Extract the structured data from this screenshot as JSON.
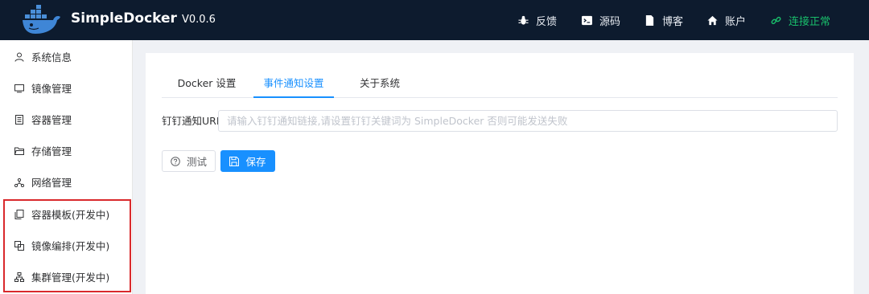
{
  "header": {
    "brand_name": "SimpleDocker",
    "version": "V0.0.6",
    "nav": [
      {
        "label": "反馈",
        "icon": "bug-icon"
      },
      {
        "label": "源码",
        "icon": "terminal-icon"
      },
      {
        "label": "博客",
        "icon": "document-icon"
      },
      {
        "label": "账户",
        "icon": "home-icon"
      }
    ],
    "status": {
      "label": "连接正常",
      "icon": "link-icon",
      "color": "#19be6b"
    }
  },
  "sidebar": {
    "items": [
      {
        "label": "系统信息",
        "icon": "user-icon"
      },
      {
        "label": "镜像管理",
        "icon": "monitor-icon"
      },
      {
        "label": "容器管理",
        "icon": "container-icon"
      },
      {
        "label": "存储管理",
        "icon": "folder-icon"
      },
      {
        "label": "网络管理",
        "icon": "network-icon"
      },
      {
        "label": "容器模板(开发中)",
        "icon": "copy-icon"
      },
      {
        "label": "镜像编排(开发中)",
        "icon": "layers-icon"
      },
      {
        "label": "集群管理(开发中)",
        "icon": "cluster-icon"
      }
    ],
    "highlight_color": "#d9292c"
  },
  "main": {
    "tabs": [
      {
        "label": "Docker 设置",
        "active": false
      },
      {
        "label": "事件通知设置",
        "active": true
      },
      {
        "label": "关于系统",
        "active": false
      }
    ],
    "field": {
      "label": "钉钉通知URL:",
      "value": "",
      "placeholder": "请输入钉钉通知链接,请设置钉钉关键词为 SimpleDocker 否则可能发送失败"
    },
    "buttons": {
      "test": {
        "label": "测试",
        "icon": "question-circle-icon"
      },
      "save": {
        "label": "保存",
        "icon": "save-icon"
      }
    },
    "accent_color": "#1890ff"
  }
}
